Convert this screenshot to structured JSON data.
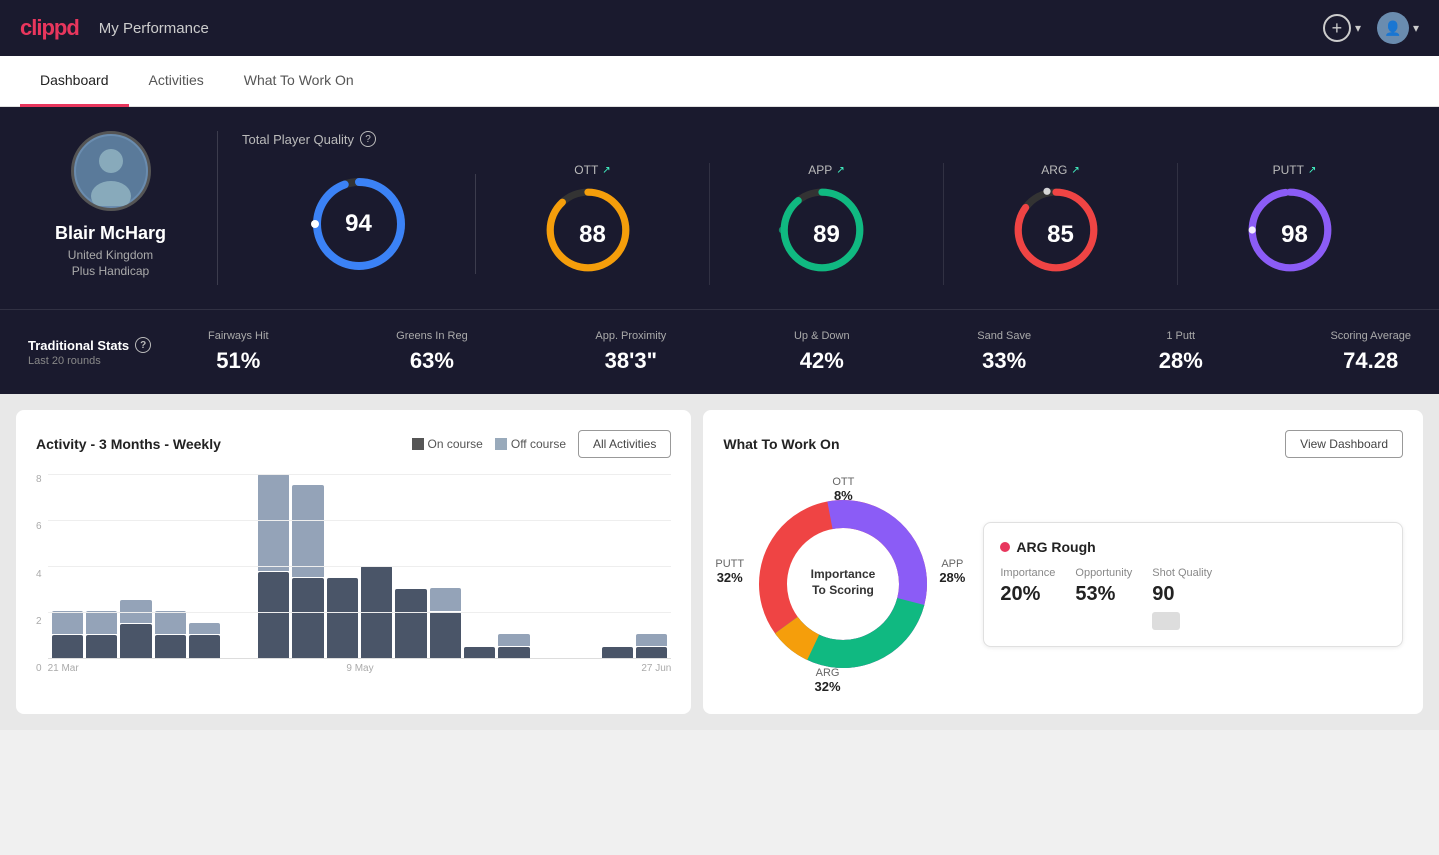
{
  "header": {
    "logo": "clippd",
    "title": "My Performance",
    "addBtn": "+",
    "chevron": "▾"
  },
  "nav": {
    "tabs": [
      {
        "label": "Dashboard",
        "active": true
      },
      {
        "label": "Activities",
        "active": false
      },
      {
        "label": "What To Work On",
        "active": false
      }
    ]
  },
  "hero": {
    "profile": {
      "name": "Blair McHarg",
      "country": "United Kingdom",
      "handicap": "Plus Handicap"
    },
    "totalPlayerQuality": {
      "label": "Total Player Quality",
      "value": 94,
      "color": "#3b82f6",
      "pct": 94
    },
    "scores": [
      {
        "label": "OTT",
        "value": 88,
        "color": "#f59e0b",
        "pct": 88,
        "trend": "↗"
      },
      {
        "label": "APP",
        "value": 89,
        "color": "#10b981",
        "pct": 89,
        "trend": "↗"
      },
      {
        "label": "ARG",
        "value": 85,
        "color": "#ef4444",
        "pct": 85,
        "trend": "↗"
      },
      {
        "label": "PUTT",
        "value": 98,
        "color": "#8b5cf6",
        "pct": 98,
        "trend": "↗"
      }
    ]
  },
  "tradStats": {
    "label": "Traditional Stats",
    "sublabel": "Last 20 rounds",
    "items": [
      {
        "label": "Fairways Hit",
        "value": "51%"
      },
      {
        "label": "Greens In Reg",
        "value": "63%"
      },
      {
        "label": "App. Proximity",
        "value": "38'3\""
      },
      {
        "label": "Up & Down",
        "value": "42%"
      },
      {
        "label": "Sand Save",
        "value": "33%"
      },
      {
        "label": "1 Putt",
        "value": "28%"
      },
      {
        "label": "Scoring Average",
        "value": "74.28"
      }
    ]
  },
  "activity": {
    "title": "Activity - 3 Months - Weekly",
    "legend": {
      "oncourse": "On course",
      "offcourse": "Off course"
    },
    "allActivitiesBtn": "All Activities",
    "yAxis": [
      "8",
      "6",
      "4",
      "2",
      "0"
    ],
    "xAxis": [
      "21 Mar",
      "9 May",
      "27 Jun"
    ],
    "bars": [
      {
        "on": 1,
        "off": 1
      },
      {
        "on": 1,
        "off": 1
      },
      {
        "on": 1.5,
        "off": 1
      },
      {
        "on": 1,
        "off": 1
      },
      {
        "on": 1,
        "off": 0.5
      },
      {
        "on": 0,
        "off": 0
      },
      {
        "on": 4,
        "off": 4.5
      },
      {
        "on": 3.5,
        "off": 4
      },
      {
        "on": 3.5,
        "off": 0
      },
      {
        "on": 4,
        "off": 0
      },
      {
        "on": 3,
        "off": 0
      },
      {
        "on": 2,
        "off": 1
      },
      {
        "on": 0.5,
        "off": 0
      },
      {
        "on": 0.5,
        "off": 0.5
      },
      {
        "on": 0,
        "off": 0
      },
      {
        "on": 0,
        "off": 0
      },
      {
        "on": 0.5,
        "off": 0
      },
      {
        "on": 0.5,
        "off": 0.5
      }
    ]
  },
  "whatToWorkOn": {
    "title": "What To Work On",
    "viewDashboardBtn": "View Dashboard",
    "donutCenter": "Importance\nTo Scoring",
    "segments": [
      {
        "label": "OTT",
        "pct": "8%",
        "color": "#f59e0b",
        "pos": {
          "top": "4%",
          "left": "50%"
        }
      },
      {
        "label": "APP",
        "pct": "28%",
        "color": "#10b981",
        "pos": {
          "top": "42%",
          "right": "-10%"
        }
      },
      {
        "label": "ARG",
        "pct": "32%",
        "color": "#ef4444",
        "pos": {
          "bottom": "2%",
          "left": "40%"
        }
      },
      {
        "label": "PUTT",
        "pct": "32%",
        "color": "#8b5cf6",
        "pos": {
          "top": "40%",
          "left": "-8%"
        }
      }
    ],
    "card": {
      "title": "ARG Rough",
      "dotColor": "#e8365d",
      "metrics": [
        {
          "label": "Importance",
          "value": "20%"
        },
        {
          "label": "Opportunity",
          "value": "53%"
        },
        {
          "label": "Shot Quality",
          "value": "90"
        }
      ]
    }
  }
}
